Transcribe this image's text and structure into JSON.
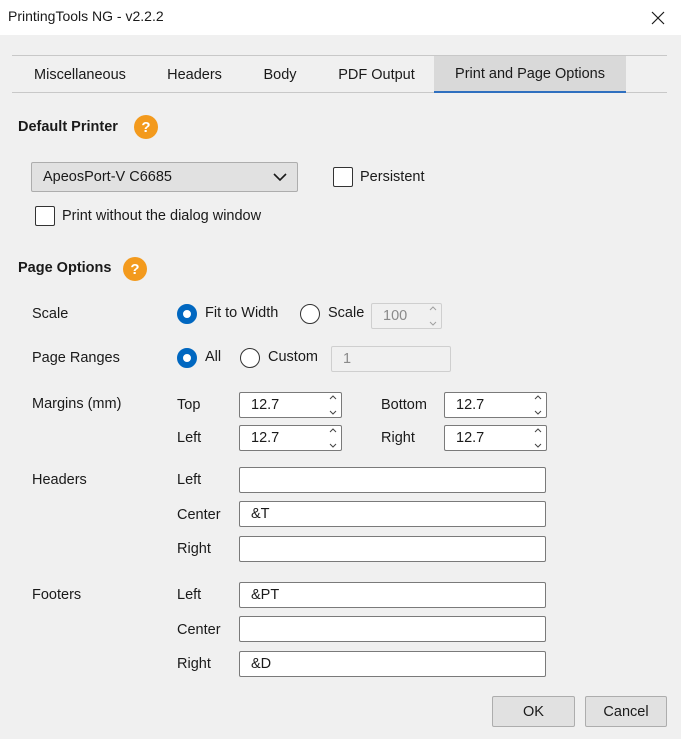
{
  "window": {
    "title": "PrintingTools NG - v2.2.2"
  },
  "tabs": [
    {
      "label": "Miscellaneous"
    },
    {
      "label": "Headers"
    },
    {
      "label": "Body"
    },
    {
      "label": "PDF Output"
    },
    {
      "label": "Print and Page Options",
      "active": true
    }
  ],
  "default_printer": {
    "title": "Default Printer",
    "help": "?",
    "selected_printer": "ApeosPort-V C6685",
    "persistent_label": "Persistent",
    "persistent_checked": false,
    "print_without_dialog_label": "Print without the dialog window",
    "print_without_dialog_checked": false
  },
  "page_options": {
    "title": "Page Options",
    "help": "?",
    "scale": {
      "label": "Scale",
      "fit_to_width_label": "Fit to Width",
      "scale_option_label": "Scale",
      "selected": "fit_to_width",
      "scale_value": "100"
    },
    "page_ranges": {
      "label": "Page Ranges",
      "all_label": "All",
      "custom_label": "Custom",
      "selected": "all",
      "custom_value": "1"
    },
    "margins": {
      "label": "Margins (mm)",
      "top_label": "Top",
      "top": "12.7",
      "bottom_label": "Bottom",
      "bottom": "12.7",
      "left_label": "Left",
      "left": "12.7",
      "right_label": "Right",
      "right": "12.7"
    },
    "headers": {
      "label": "Headers",
      "left_label": "Left",
      "left": "",
      "center_label": "Center",
      "center": "&T",
      "right_label": "Right",
      "right": ""
    },
    "footers": {
      "label": "Footers",
      "left_label": "Left",
      "left": "&PT",
      "center_label": "Center",
      "center": "",
      "right_label": "Right",
      "right": "&D"
    }
  },
  "buttons": {
    "ok": "OK",
    "cancel": "Cancel"
  },
  "colors": {
    "accent": "#0067c0",
    "help_badge": "#f39a1d",
    "tab_underline": "#2f6fbf"
  }
}
